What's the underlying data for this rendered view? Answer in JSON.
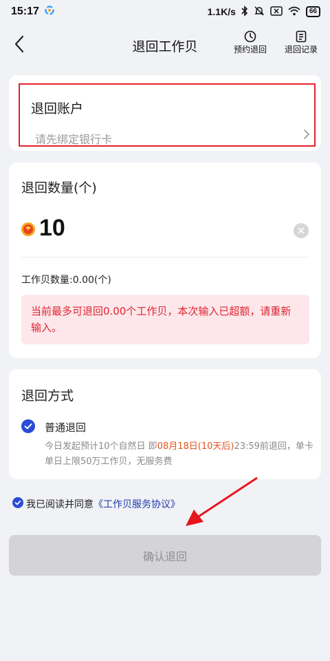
{
  "status_bar": {
    "time": "15:17",
    "net_speed": "1.1K/s",
    "battery": "66"
  },
  "nav": {
    "title": "退回工作贝",
    "action_schedule": "预约退回",
    "action_records": "退回记录"
  },
  "account": {
    "title": "退回账户",
    "placeholder": "请先绑定银行卡"
  },
  "quantity": {
    "title": "退回数量(个)",
    "value": "10",
    "balance": "工作贝数量:0.00(个)",
    "error": "当前最多可退回0.00个工作贝，本次输入已超额，请重新输入。"
  },
  "method": {
    "title": "退回方式",
    "option_label": "普通退回",
    "desc_prefix": "今日发起预计10个自然日 即",
    "desc_highlight": "08月18日(10天后)",
    "desc_suffix": "23:59前退回，单卡单日上限50万工作贝，无服务费"
  },
  "agreement": {
    "prefix": "我已阅读并同意",
    "link": "《工作贝服务协议》"
  },
  "confirm_label": "确认退回",
  "colors": {
    "accent_blue": "#2a4bd6",
    "error_red": "#e02433",
    "highlight_orange": "#e2541d",
    "box_red": "#e3202c"
  }
}
